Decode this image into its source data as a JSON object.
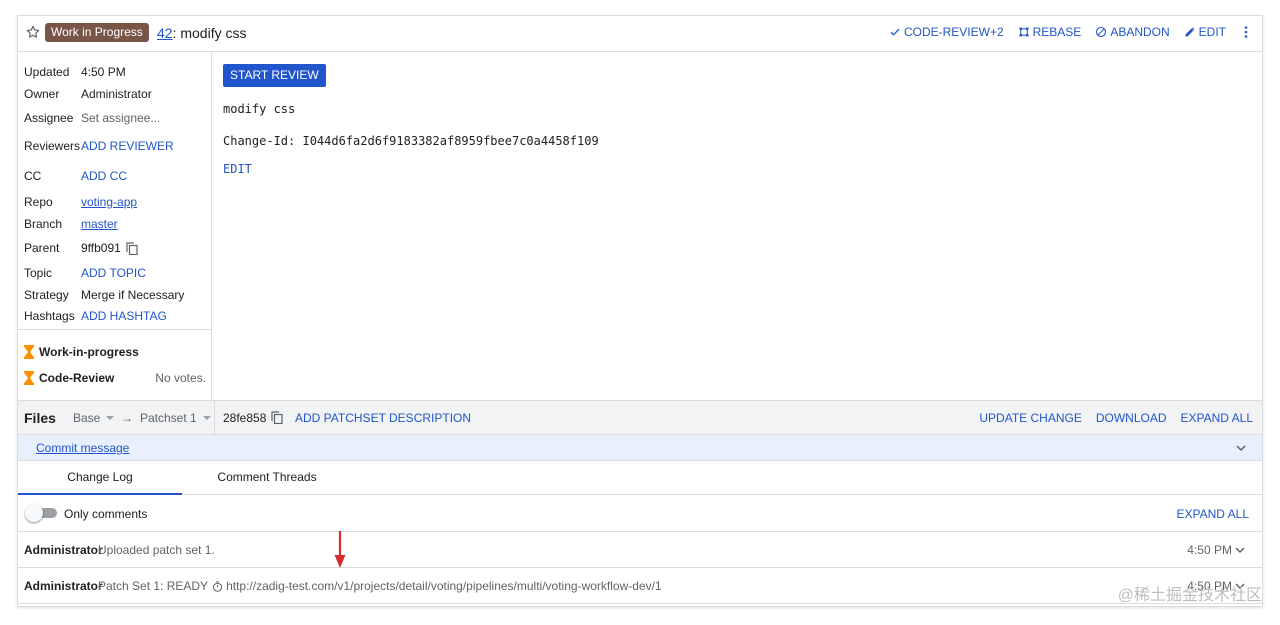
{
  "header": {
    "wip_badge": "Work in Progress",
    "change_number": "42",
    "title_sep": ":",
    "change_title": "modify css",
    "actions": [
      {
        "label": "CODE-REVIEW+2",
        "icon": "check-icon"
      },
      {
        "label": "REBASE",
        "icon": "rebase-icon"
      },
      {
        "label": "ABANDON",
        "icon": "block-icon"
      },
      {
        "label": "EDIT",
        "icon": "pencil-icon"
      }
    ]
  },
  "sidebar": {
    "updated_label": "Updated",
    "updated_value": "4:50 PM",
    "owner_label": "Owner",
    "owner_value": "Administrator",
    "assignee_label": "Assignee",
    "assignee_value": "Set assignee...",
    "reviewers_label": "Reviewers",
    "reviewers_value": "ADD REVIEWER",
    "cc_label": "CC",
    "cc_value": "ADD CC",
    "repo_label": "Repo",
    "repo_value": "voting-app",
    "branch_label": "Branch",
    "branch_value": "master",
    "parent_label": "Parent",
    "parent_value": "9ffb091",
    "topic_label": "Topic",
    "topic_value": "ADD TOPIC",
    "strategy_label": "Strategy",
    "strategy_value": "Merge if Necessary",
    "hashtags_label": "Hashtags",
    "hashtags_value": "ADD HASHTAG",
    "labels": [
      {
        "name": "Work-in-progress",
        "value": ""
      },
      {
        "name": "Code-Review",
        "value": "No votes."
      }
    ]
  },
  "main": {
    "start_review": "START REVIEW",
    "commit_message": "modify css\n\nChange-Id: I044d6fa2d6f9183382af8959fbee7c0a4458f109",
    "edit_label": "EDIT"
  },
  "files": {
    "title": "Files",
    "base": "Base",
    "arrow": "→",
    "patchset": "Patchset 1",
    "hash": "28fe858",
    "add_description": "ADD PATCHSET DESCRIPTION",
    "update_change": "UPDATE CHANGE",
    "download": "DOWNLOAD",
    "expand_all": "EXPAND ALL"
  },
  "commit_message_row": {
    "label": "Commit message"
  },
  "tabs": {
    "change_log": "Change Log",
    "comment_threads": "Comment Threads"
  },
  "log_controls": {
    "only_comments": "Only comments",
    "expand_all": "EXPAND ALL",
    "only_comments_on": false
  },
  "log": [
    {
      "author": "Administrator",
      "text": "Uploaded patch set 1.",
      "time": "4:50 PM"
    },
    {
      "author": "Administrator",
      "text_prefix": "Patch Set 1: READY",
      "text_url": "http://zadig-test.com/v1/projects/detail/voting/pipelines/multi/voting-workflow-dev/1",
      "time": "4:50 PM"
    }
  ],
  "watermark": "@稀土掘金技术社区",
  "colors": {
    "accent": "#2155cb",
    "wip_badge": "#795548",
    "hourglass": "#ff8f00",
    "annotation_arrow": "#d32f2f"
  }
}
